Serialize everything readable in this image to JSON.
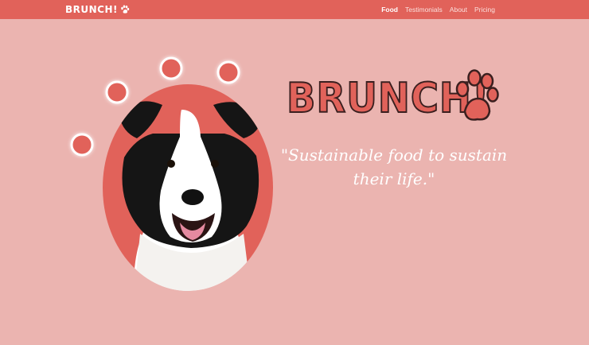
{
  "navbar": {
    "brand_text": "BRUNCH!",
    "brand_icon": "paw-icon",
    "links": [
      {
        "label": "Food",
        "active": true
      },
      {
        "label": "Testimonials",
        "active": false
      },
      {
        "label": "About",
        "active": false
      },
      {
        "label": "Pricing",
        "active": false
      }
    ]
  },
  "hero": {
    "title": "BRUNCH!",
    "title_icon": "paw-icon",
    "tagline": "\"Sustainable food to sustain their life.\"",
    "image": "border-collie-dog"
  },
  "colors": {
    "navbar": "#e1625a",
    "background": "#ebb4b0",
    "accent": "#e1625a",
    "outline": "#3a1f1f",
    "text": "#ffffff"
  }
}
